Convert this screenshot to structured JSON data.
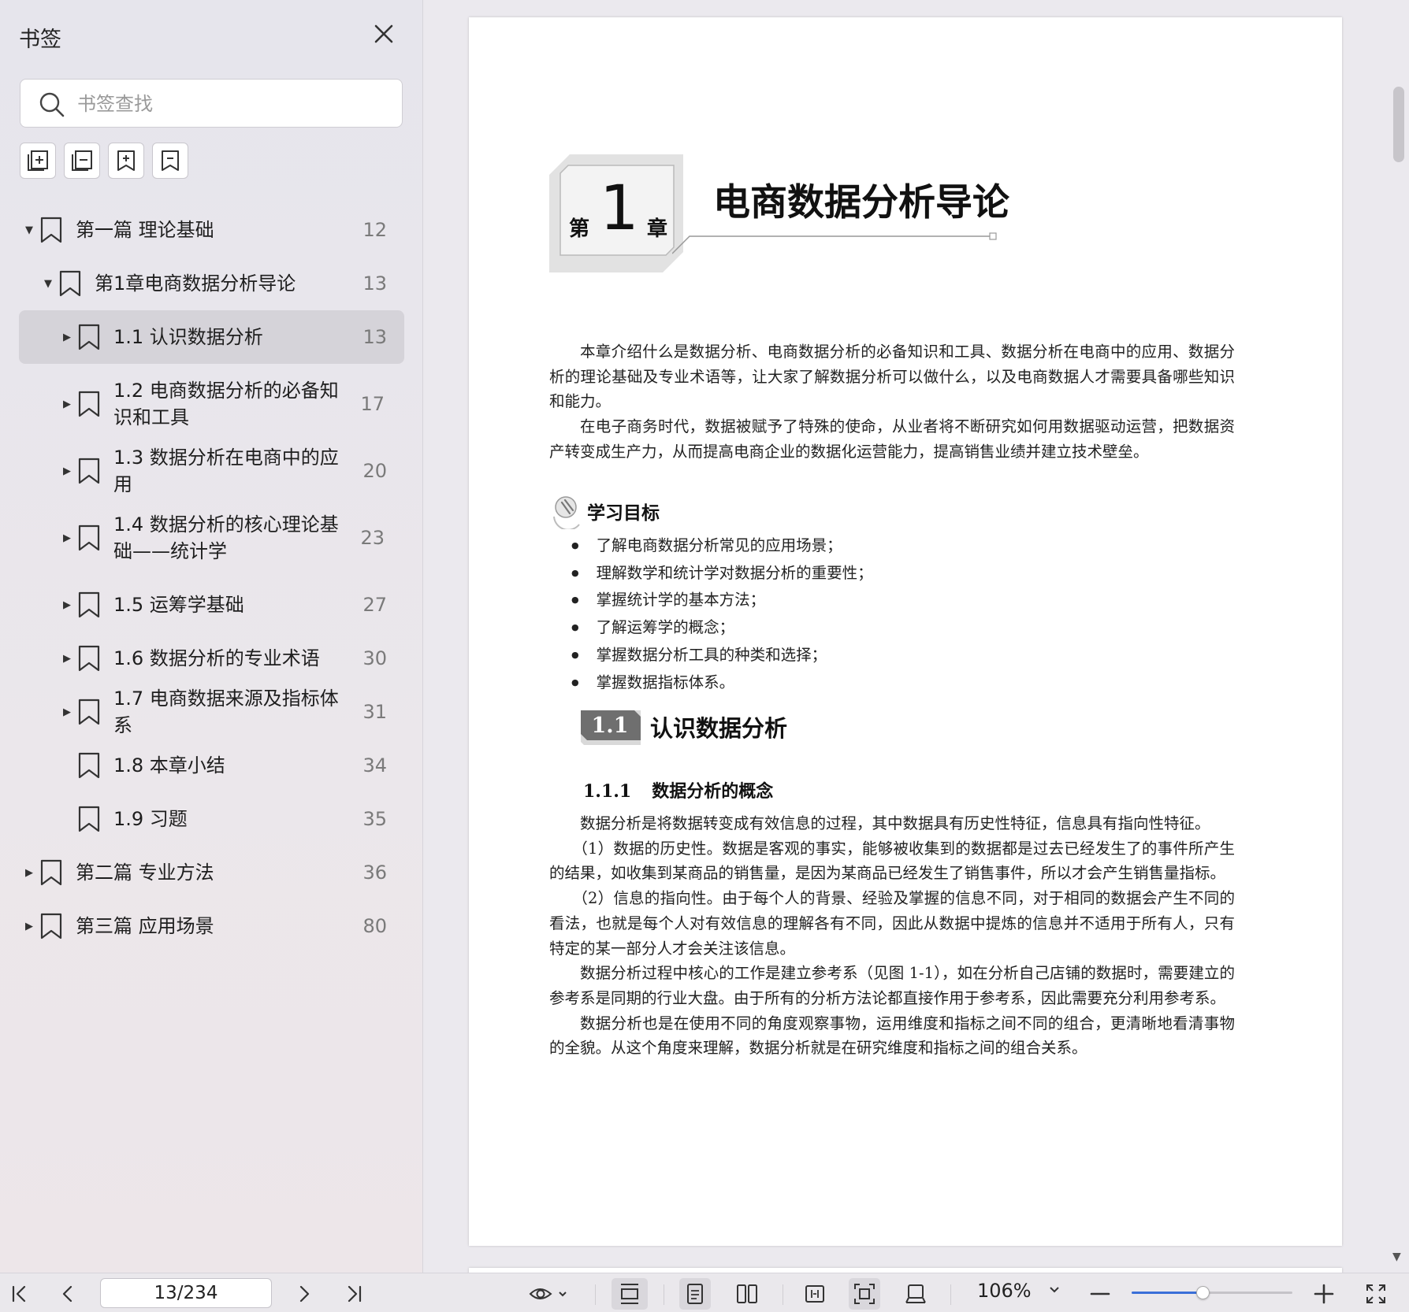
{
  "sidebar": {
    "title": "书签",
    "search_placeholder": "书签查找",
    "tools": [
      {
        "name": "expand-all-bookmarks-icon"
      },
      {
        "name": "collapse-all-bookmarks-icon"
      },
      {
        "name": "add-bookmark-icon"
      },
      {
        "name": "remove-bookmark-icon"
      }
    ],
    "items": [
      {
        "label": "第一篇 理论基础",
        "page": "12",
        "level": 0,
        "arrow": "▼"
      },
      {
        "label": "第1章电商数据分析导论",
        "page": "13",
        "level": 1,
        "arrow": "▼"
      },
      {
        "label": "1.1 认识数据分析",
        "page": "13",
        "level": 2,
        "arrow": "▶",
        "selected": true
      },
      {
        "label": "1.2 电商数据分析的必备知识和工具",
        "page": "17",
        "level": 2,
        "arrow": "▶"
      },
      {
        "label": "1.3 数据分析在电商中的应用",
        "page": "20",
        "level": 2,
        "arrow": "▶"
      },
      {
        "label": "1.4 数据分析的核心理论基础——统计学",
        "page": "23",
        "level": 2,
        "arrow": "▶"
      },
      {
        "label": "1.5 运筹学基础",
        "page": "27",
        "level": 2,
        "arrow": "▶"
      },
      {
        "label": "1.6 数据分析的专业术语",
        "page": "30",
        "level": 2,
        "arrow": "▶"
      },
      {
        "label": "1.7 电商数据来源及指标体系",
        "page": "31",
        "level": 2,
        "arrow": "▶"
      },
      {
        "label": "1.8 本章小结",
        "page": "34",
        "level": 2,
        "arrow": ""
      },
      {
        "label": "1.9 习题",
        "page": "35",
        "level": 2,
        "arrow": ""
      },
      {
        "label": "第二篇 专业方法",
        "page": "36",
        "level": 0,
        "arrow": "▶"
      },
      {
        "label": "第三篇 应用场景",
        "page": "80",
        "level": 0,
        "arrow": "▶"
      }
    ]
  },
  "document": {
    "chapter_prefix": "第",
    "chapter_number": "1",
    "chapter_suffix": "章",
    "chapter_title": "电商数据分析导论",
    "intro": [
      "本章介绍什么是数据分析、电商数据分析的必备知识和工具、数据分析在电商中的应用、数据分析的理论基础及专业术语等，让大家了解数据分析可以做什么，以及电商数据人才需要具备哪些知识和能力。",
      "在电子商务时代，数据被赋予了特殊的使命，从业者将不断研究如何用数据驱动运营，把数据资产转变成生产力，从而提高电商企业的数据化运营能力，提高销售业绩并建立技术壁垒。"
    ],
    "goals_heading": "学习目标",
    "goals": [
      "了解电商数据分析常见的应用场景；",
      "理解数学和统计学对数据分析的重要性；",
      "掌握统计学的基本方法；",
      "了解运筹学的概念；",
      "掌握数据分析工具的种类和选择；",
      "掌握数据指标体系。"
    ],
    "section_number": "1.1",
    "section_title": "认识数据分析",
    "subsection_number": "1.1.1",
    "subsection_title": "数据分析的概念",
    "body": [
      "数据分析是将数据转变成有效信息的过程，其中数据具有历史性特征，信息具有指向性特征。",
      "（1）数据的历史性。数据是客观的事实，能够被收集到的数据都是过去已经发生了的事件所产生的结果，如收集到某商品的销售量，是因为某商品已经发生了销售事件，所以才会产生销售量指标。",
      "（2）信息的指向性。由于每个人的背景、经验及掌握的信息不同，对于相同的数据会产生不同的看法，也就是每个人对有效信息的理解各有不同，因此从数据中提炼的信息并不适用于所有人，只有特定的某一部分人才会关注该信息。",
      "数据分析过程中核心的工作是建立参考系（见图 1-1），如在分析自己店铺的数据时，需要建立的参考系是同期的行业大盘。由于所有的分析方法论都直接作用于参考系，因此需要充分利用参考系。",
      "数据分析也是在使用不同的角度观察事物，运用维度和指标之间不同的组合，更清晰地看清事物的全貌。从这个角度来理解，数据分析就是在研究维度和指标之间的组合关系。"
    ]
  },
  "toolbar": {
    "page_indicator": "13/234",
    "zoom": "106%",
    "zoom_fraction": 0.44,
    "accent_color": "#3a6fd8"
  }
}
